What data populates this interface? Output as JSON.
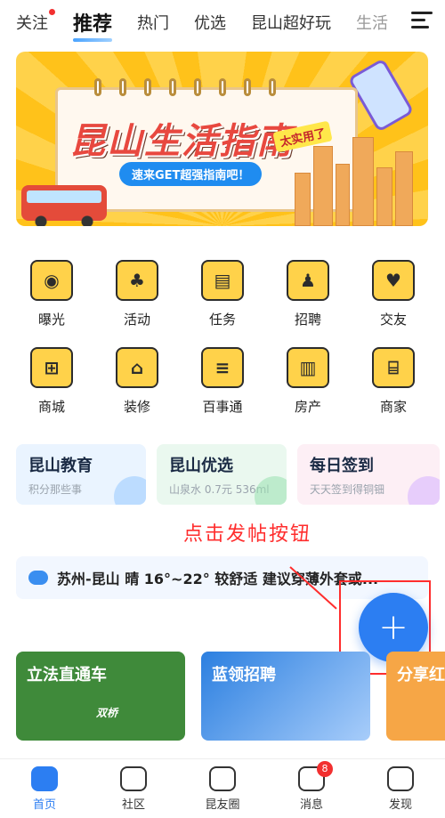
{
  "top_tabs": [
    {
      "label": "关注",
      "has_dot": true
    },
    {
      "label": "推荐",
      "active": true
    },
    {
      "label": "热门"
    },
    {
      "label": "优选"
    },
    {
      "label": "昆山超好玩"
    },
    {
      "label": "生活"
    }
  ],
  "banner": {
    "title": "昆山生活指南",
    "subtitle": "速来GET超强指南吧！",
    "badge": "太实用了"
  },
  "grid": [
    {
      "label": "曝光",
      "icon": "camera-icon"
    },
    {
      "label": "活动",
      "icon": "plant-icon"
    },
    {
      "label": "任务",
      "icon": "briefcase-icon"
    },
    {
      "label": "招聘",
      "icon": "person-icon"
    },
    {
      "label": "交友",
      "icon": "heart-icon"
    },
    {
      "label": "商城",
      "icon": "cart-icon"
    },
    {
      "label": "装修",
      "icon": "hammer-icon"
    },
    {
      "label": "百事通",
      "icon": "books-icon"
    },
    {
      "label": "房产",
      "icon": "building-icon"
    },
    {
      "label": "商家",
      "icon": "store-icon"
    }
  ],
  "cards": [
    {
      "title": "昆山教育",
      "sub": "积分那些事"
    },
    {
      "title": "昆山优选",
      "sub": "山泉水 0.7元 536ml"
    },
    {
      "title": "每日签到",
      "sub": "天天签到得铜钿"
    }
  ],
  "annotation": "点击发帖按钮",
  "weather": "苏州-昆山 晴 16°~22° 较舒适 建议穿薄外套或...",
  "fab_label": "+",
  "features": [
    {
      "title": "立法直通车",
      "seal": "双桥"
    },
    {
      "title": "蓝领招聘"
    },
    {
      "title": "分享红"
    }
  ],
  "nav": [
    {
      "label": "首页",
      "icon": "home-icon",
      "active": true
    },
    {
      "label": "社区",
      "icon": "community-icon"
    },
    {
      "label": "昆友圈",
      "icon": "circle-icon"
    },
    {
      "label": "消息",
      "icon": "message-icon",
      "badge": "8"
    },
    {
      "label": "发现",
      "icon": "rocket-icon"
    }
  ],
  "colors": {
    "accent": "#2c7ef2",
    "annotation": "#ff2d2d",
    "badge": "#f23030"
  }
}
